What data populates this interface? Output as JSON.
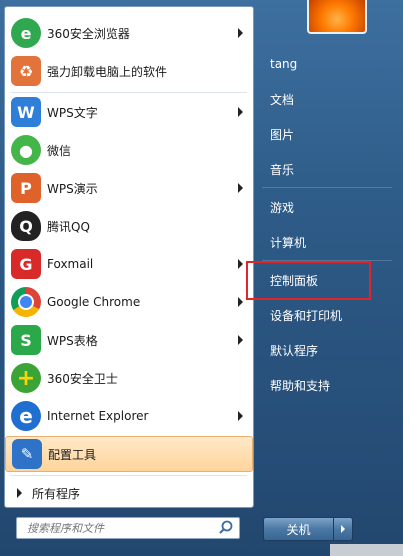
{
  "programs": [
    {
      "label": "360安全浏览器",
      "icon": "360-browser-icon",
      "color": "#2fa84f",
      "glyph": "e",
      "arrow": true
    },
    {
      "label": "强力卸载电脑上的软件",
      "icon": "uninstaller-icon",
      "color": "#e2733a",
      "glyph": "♻",
      "arrow": false
    },
    {
      "label": "WPS文字",
      "icon": "wps-writer-icon",
      "color": "#2f7fd9",
      "glyph": "W",
      "arrow": true
    },
    {
      "label": "微信",
      "icon": "wechat-icon",
      "color": "#44b549",
      "glyph": "●",
      "arrow": false
    },
    {
      "label": "WPS演示",
      "icon": "wps-presentation-icon",
      "color": "#e0622b",
      "glyph": "P",
      "arrow": true
    },
    {
      "label": "腾讯QQ",
      "icon": "qq-penguin-icon",
      "color": "#222222",
      "glyph": "Q",
      "arrow": false
    },
    {
      "label": "Foxmail",
      "icon": "foxmail-icon",
      "color": "#d92a2a",
      "glyph": "G",
      "arrow": true
    },
    {
      "label": "Google Chrome",
      "icon": "chrome-icon",
      "color": "#4285f4",
      "glyph": "◉",
      "arrow": true
    },
    {
      "label": "WPS表格",
      "icon": "wps-spreadsheet-icon",
      "color": "#2aa84a",
      "glyph": "S",
      "arrow": true
    },
    {
      "label": "360安全卫士",
      "icon": "360-security-icon",
      "color": "#3aa536",
      "glyph": "+",
      "arrow": false
    },
    {
      "label": "Internet Explorer",
      "icon": "ie-icon",
      "color": "#1e6fd0",
      "glyph": "e",
      "arrow": true
    },
    {
      "label": "配置工具",
      "icon": "config-tool-icon",
      "color": "#2f73c9",
      "glyph": "🔧",
      "arrow": false
    }
  ],
  "all_programs": "所有程序",
  "search": {
    "placeholder": "搜索程序和文件"
  },
  "right_items": [
    "tang",
    "文档",
    "图片",
    "音乐",
    "游戏",
    "计算机",
    "控制面板",
    "设备和打印机",
    "默认程序",
    "帮助和支持"
  ],
  "shutdown": {
    "label": "关机"
  }
}
